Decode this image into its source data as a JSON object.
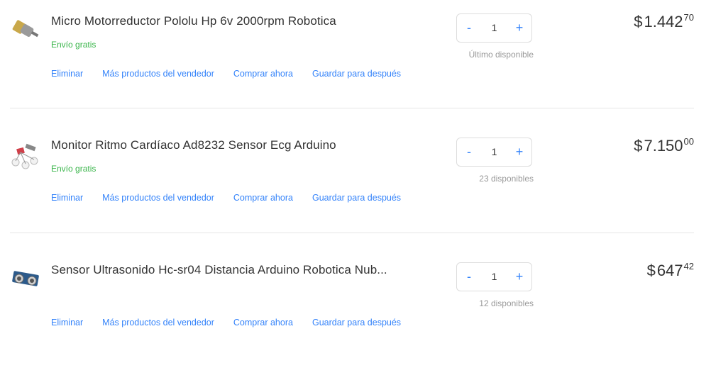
{
  "items": [
    {
      "title": "Micro Motorreductor Pololu Hp 6v 2000rpm Robotica",
      "shipping": "Envío gratis",
      "quantity": "1",
      "availability": "Último disponible",
      "price_currency": "$",
      "price_int": "1.442",
      "price_dec": "70",
      "image_icon": "motor-icon"
    },
    {
      "title": "Monitor Ritmo Cardíaco Ad8232 Sensor Ecg Arduino",
      "shipping": "Envío gratis",
      "quantity": "1",
      "availability": "23 disponibles",
      "price_currency": "$",
      "price_int": "7.150",
      "price_dec": "00",
      "image_icon": "ecg-sensor-icon"
    },
    {
      "title": "Sensor Ultrasonido Hc-sr04 Distancia Arduino Robotica Nub...",
      "shipping": "",
      "quantity": "1",
      "availability": "12 disponibles",
      "price_currency": "$",
      "price_int": "647",
      "price_dec": "42",
      "image_icon": "ultrasonic-sensor-icon"
    }
  ],
  "actions": {
    "delete": "Eliminar",
    "more_from_seller": "Más productos del vendedor",
    "buy_now": "Comprar ahora",
    "save_later": "Guardar para después"
  },
  "qty_controls": {
    "minus": "-",
    "plus": "+"
  },
  "colors": {
    "link": "#3483fa",
    "free_shipping": "#39b54a",
    "separator": "#e6e6e6"
  }
}
